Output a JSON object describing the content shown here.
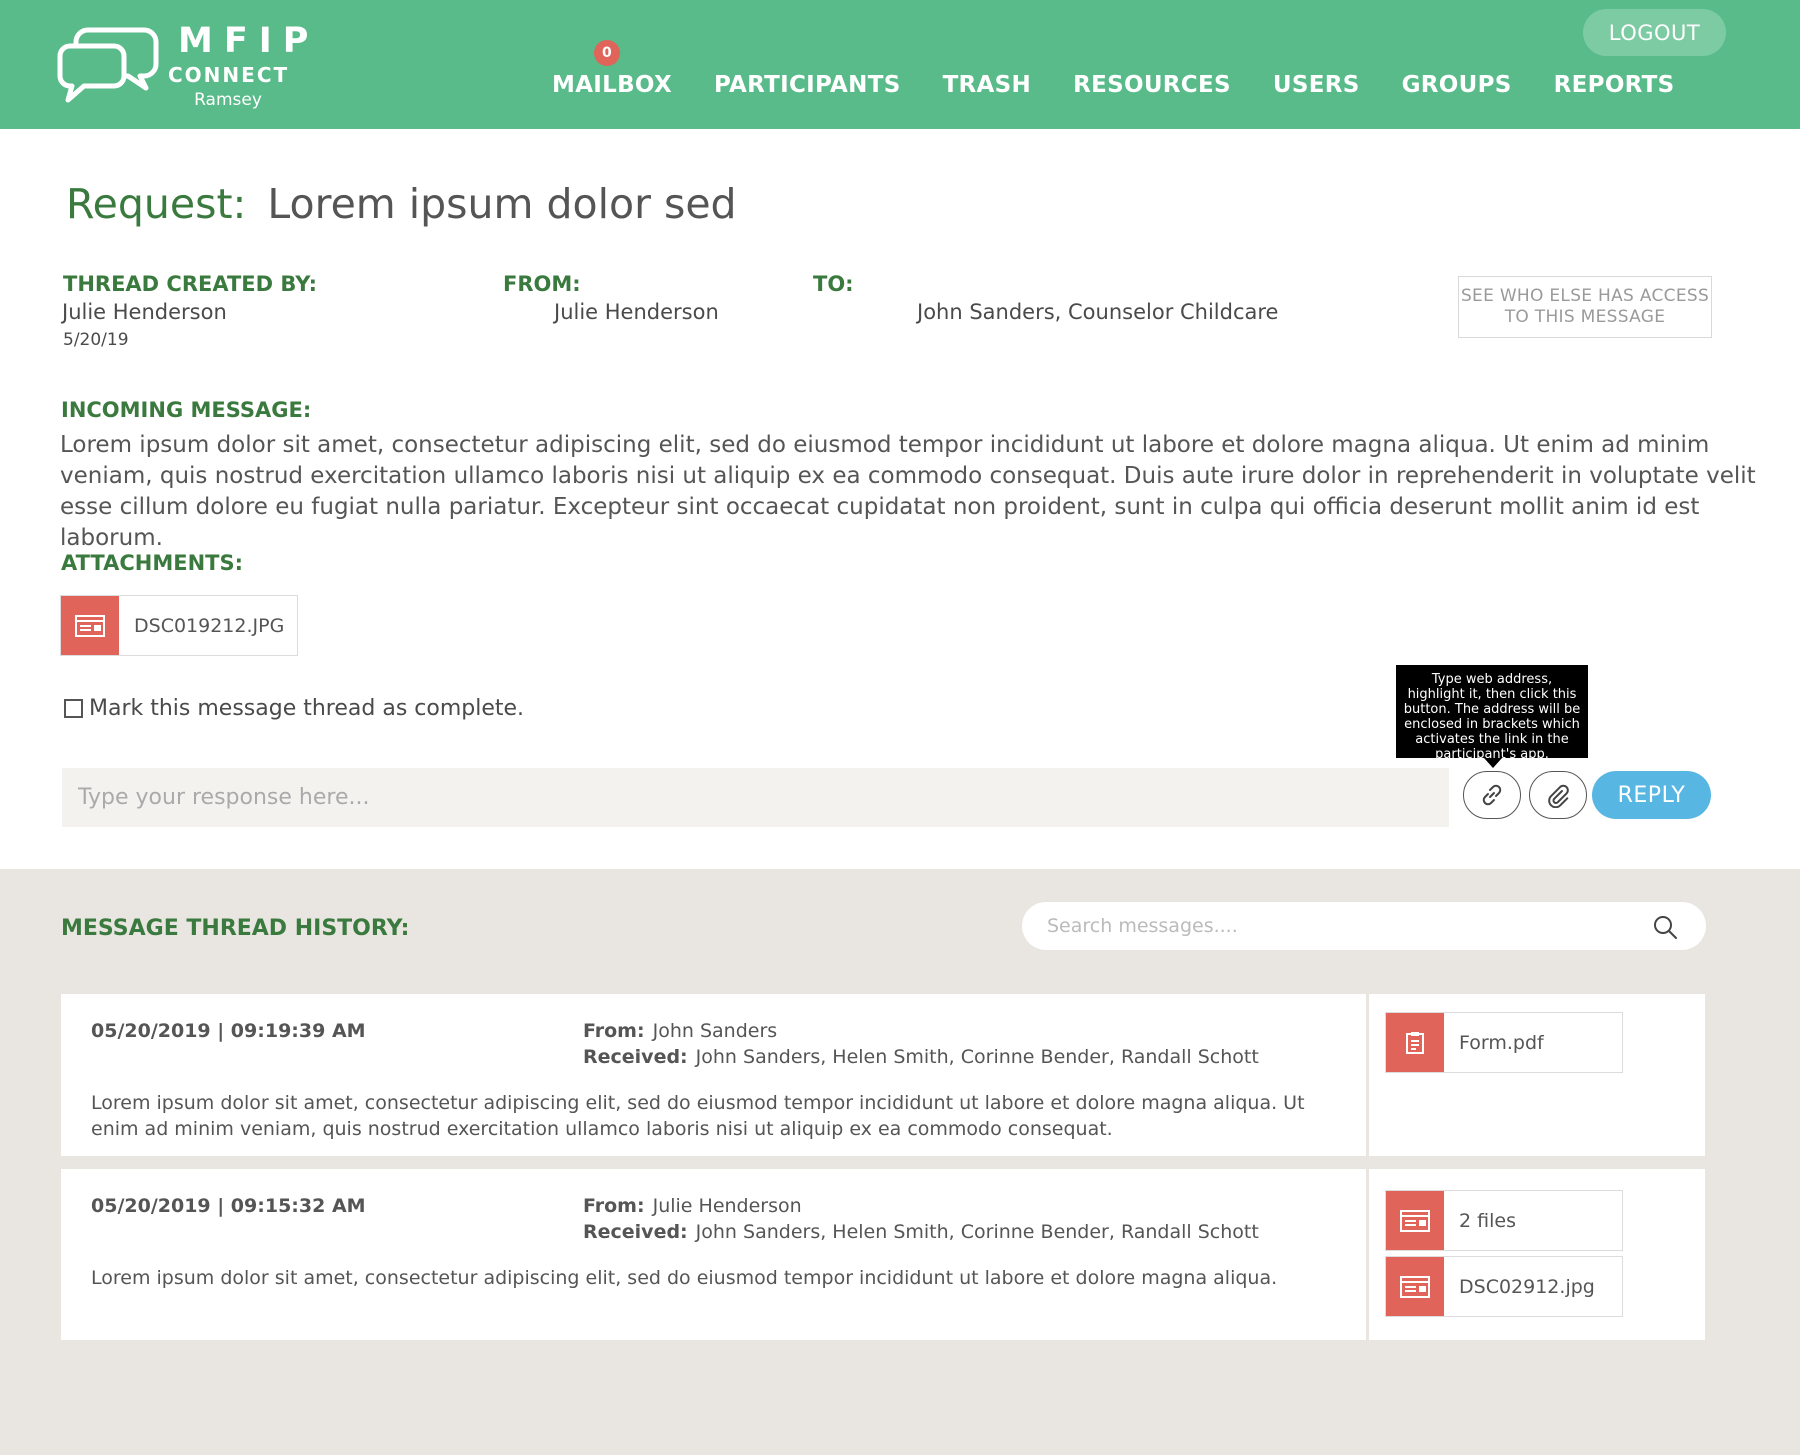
{
  "brand": {
    "title": "MFIP",
    "subtitle": "CONNECT",
    "county": "Ramsey"
  },
  "nav": {
    "mailbox_badge": "0",
    "items": [
      "MAILBOX",
      "PARTICIPANTS",
      "TRASH",
      "RESOURCES",
      "USERS",
      "GROUPS",
      "REPORTS"
    ],
    "logout": "LOGOUT"
  },
  "request": {
    "label": "Request:",
    "subject": "Lorem ipsum dolor sed",
    "created_by_label": "THREAD CREATED BY:",
    "created_by": "Julie Henderson",
    "created_date": "5/20/19",
    "from_label": "FROM:",
    "from": "Julie Henderson",
    "to_label": "TO:",
    "to": "John Sanders, Counselor Childcare",
    "access_button": "SEE WHO ELSE HAS ACCESS TO THIS MESSAGE",
    "incoming_label": "INCOMING MESSAGE:",
    "incoming_body": "Lorem ipsum dolor sit amet, consectetur adipiscing elit, sed do eiusmod tempor incididunt ut labore et dolore magna aliqua. Ut enim ad minim veniam, quis nostrud exercitation ullamco laboris nisi ut aliquip ex ea commodo consequat. Duis aute irure dolor in reprehenderit in voluptate velit esse cillum dolore eu fugiat nulla pariatur. Excepteur sint occaecat cupidatat non proident, sunt in culpa qui officia deserunt mollit anim id est laborum.",
    "attachments_label": "ATTACHMENTS:",
    "attachment_name": "DSC019212.JPG",
    "complete_label": "Mark this message thread as complete.",
    "tooltip": "Type web address, highlight it, then click this button. The address will be enclosed in brackets which activates the link in the participant's app.",
    "response_placeholder": "Type your response here...",
    "reply_button": "REPLY"
  },
  "history": {
    "title": "MESSAGE THREAD HISTORY:",
    "search_placeholder": "Search messages....",
    "from_label": "From:",
    "received_label": "Received:",
    "rows": [
      {
        "timestamp": "05/20/2019  |  09:19:39 AM",
        "from": "John Sanders",
        "received": "John Sanders, Helen Smith, Corinne Bender, Randall Schott",
        "body": "Lorem ipsum dolor sit amet, consectetur adipiscing elit, sed do eiusmod tempor incididunt ut labore et dolore magna aliqua. Ut enim ad minim veniam, quis nostrud exercitation ullamco laboris nisi ut aliquip ex ea commodo consequat.",
        "attachments": [
          "Form.pdf"
        ]
      },
      {
        "timestamp": "05/20/2019  |  09:15:32 AM",
        "from": "Julie Henderson",
        "received": "John Sanders, Helen Smith, Corinne Bender, Randall Schott",
        "body": "Lorem ipsum dolor sit amet, consectetur adipiscing elit, sed do eiusmod tempor incididunt ut labore et dolore magna aliqua.",
        "attachments": [
          "2 files",
          "DSC02912.jpg"
        ]
      }
    ]
  },
  "colors": {
    "header": "#59bb89",
    "accent_green": "#3b7a3e",
    "attachment_red": "#e06459",
    "reply_blue": "#58b6e2",
    "history_bg": "#e9e6e1"
  },
  "icons": {
    "logo": "speech-bubbles-icon",
    "image_attachment": "image-card-icon",
    "document_attachment": "clipboard-icon",
    "link": "link-icon",
    "paperclip": "paperclip-icon",
    "search": "search-icon"
  }
}
